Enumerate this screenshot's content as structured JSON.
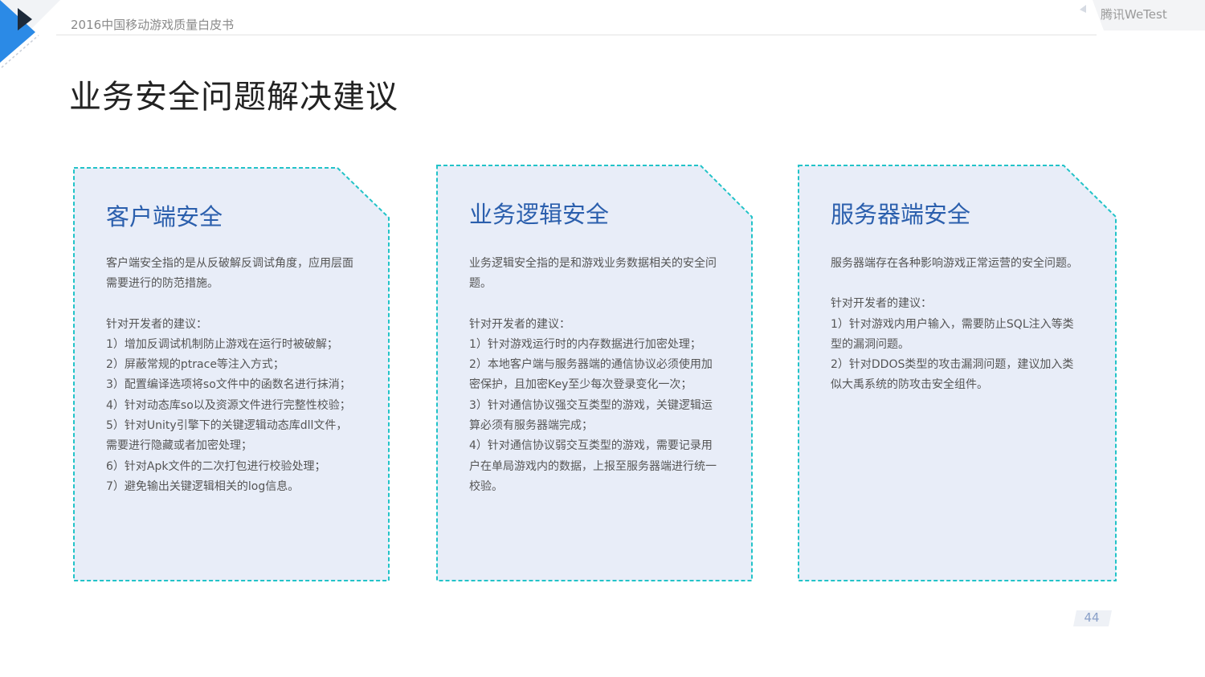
{
  "header": {
    "doc_title": "2016中国移动游戏质量白皮书",
    "brand": "腾讯WeTest"
  },
  "page_title": "业务安全问题解决建议",
  "colors": {
    "accent_blue": "#2b8ae6",
    "card_fill": "#e8edf8",
    "card_border": "#22c3c8",
    "card_title": "#2b5fad"
  },
  "cards": [
    {
      "title": "客户端安全",
      "intro": [
        "客户端安全指的是从反破解反调试角度，应用层面",
        "需要进行的防范措施。"
      ],
      "advice_label": "针对开发者的建议：",
      "lines": [
        "1）增加反调试机制防止游戏在运行时被破解；",
        "2）屏蔽常规的ptrace等注入方式；",
        "3）配置编译选项将so文件中的函数名进行抹消；",
        "4）针对动态库so以及资源文件进行完整性校验；",
        "5）针对Unity引擎下的关键逻辑动态库dll文件，",
        "需要进行隐藏或者加密处理；",
        "6）针对Apk文件的二次打包进行校验处理；",
        "7）避免输出关键逻辑相关的log信息。"
      ]
    },
    {
      "title": "业务逻辑安全",
      "intro": [
        "业务逻辑安全指的是和游戏业务数据相关的安全问",
        "题。"
      ],
      "advice_label": "针对开发者的建议：",
      "lines": [
        "1）针对游戏运行时的内存数据进行加密处理；",
        "2）本地客户端与服务器端的通信协议必须使用加",
        "密保护，且加密Key至少每次登录变化一次；",
        "3）针对通信协议强交互类型的游戏，关键逻辑运",
        "算必须有服务器端完成；",
        "4）针对通信协议弱交互类型的游戏，需要记录用",
        "户在单局游戏内的数据，上报至服务器端进行统一",
        "校验。"
      ]
    },
    {
      "title": "服务器端安全",
      "intro": [
        "服务器端存在各种影响游戏正常运营的安全问题。"
      ],
      "advice_label": "针对开发者的建议：",
      "lines": [
        "1）针对游戏内用户输入，需要防止SQL注入等类",
        "型的漏洞问题。",
        "2）针对DDOS类型的攻击漏洞问题，建议加入类",
        "似大禹系统的防攻击安全组件。"
      ]
    }
  ],
  "page_number": "44"
}
